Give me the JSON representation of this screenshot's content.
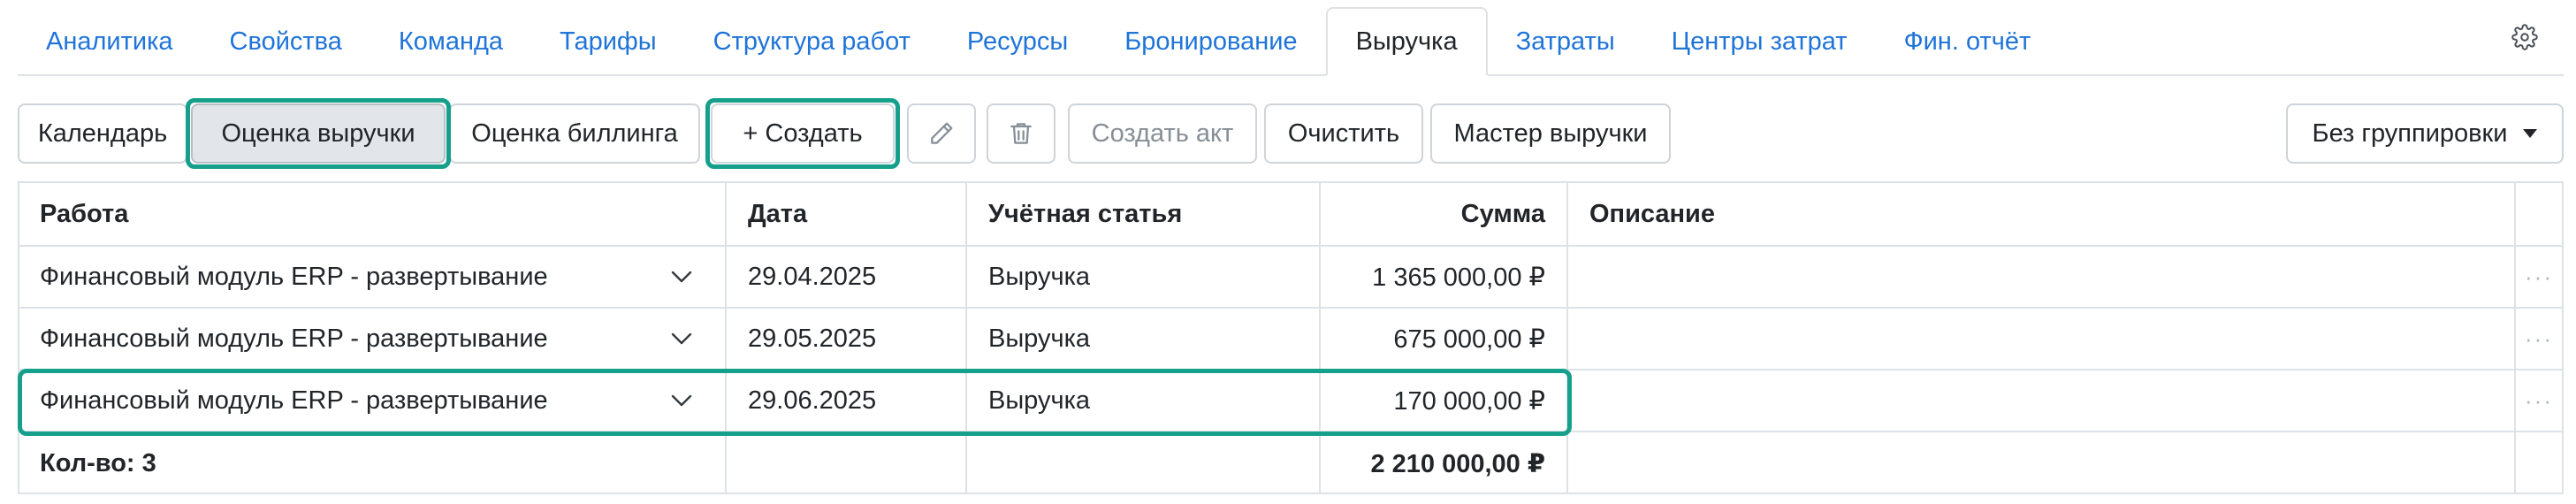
{
  "tabs": [
    {
      "label": "Аналитика",
      "active": false
    },
    {
      "label": "Свойства",
      "active": false
    },
    {
      "label": "Команда",
      "active": false
    },
    {
      "label": "Тарифы",
      "active": false
    },
    {
      "label": "Структура работ",
      "active": false
    },
    {
      "label": "Ресурсы",
      "active": false
    },
    {
      "label": "Бронирование",
      "active": false
    },
    {
      "label": "Выручка",
      "active": true
    },
    {
      "label": "Затраты",
      "active": false
    },
    {
      "label": "Центры затрат",
      "active": false
    },
    {
      "label": "Фин. отчёт",
      "active": false
    }
  ],
  "settings_icon": "gear-icon",
  "toolbar": {
    "calendar": "Календарь",
    "revenue_estimate": "Оценка выручки",
    "billing_estimate": "Оценка биллинга",
    "create": "+ Создать",
    "edit_icon": "pencil-icon",
    "delete_icon": "trash-icon",
    "create_act": "Создать акт",
    "clear": "Очистить",
    "revenue_wizard": "Мастер выручки",
    "grouping": "Без группировки"
  },
  "table": {
    "columns": {
      "work": "Работа",
      "date": "Дата",
      "article": "Учётная статья",
      "amount": "Сумма",
      "description": "Описание"
    },
    "rows": [
      {
        "work": "Финансовый модуль ERP - развертывание",
        "date": "29.04.2025",
        "article": "Выручка",
        "amount": "1 365 000,00 ₽",
        "description": "",
        "menu": "···"
      },
      {
        "work": "Финансовый модуль ERP - развертывание",
        "date": "29.05.2025",
        "article": "Выручка",
        "amount": "675 000,00 ₽",
        "description": "",
        "menu": "···"
      },
      {
        "work": "Финансовый модуль ERP - развертывание",
        "date": "29.06.2025",
        "article": "Выручка",
        "amount": "170 000,00 ₽",
        "description": "",
        "menu": "···"
      }
    ],
    "footer": {
      "count": "Кол-во: 3",
      "total": "2 210 000,00 ₽"
    }
  },
  "colors": {
    "link": "#1f74d8",
    "highlight": "#16a08c",
    "border": "#dee2e6"
  }
}
